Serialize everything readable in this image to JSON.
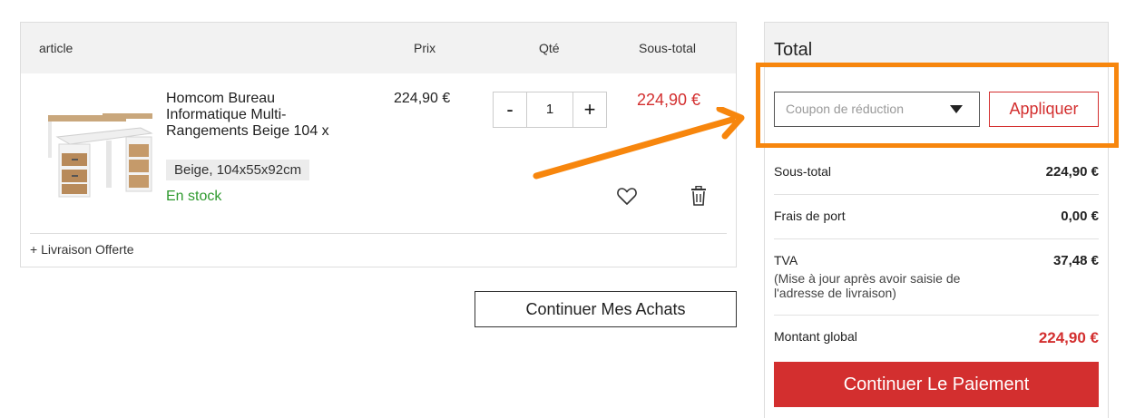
{
  "cart": {
    "headers": {
      "article": "article",
      "prix": "Prix",
      "qte": "Qté",
      "sous_total": "Sous-total"
    },
    "product": {
      "name": "Homcom Bureau Informatique Multi-Rangements Beige 104 x",
      "variant": "Beige, 104x55x92cm",
      "stock": "En stock",
      "price": "224,90 €",
      "quantity": "1",
      "qty_minus": "-",
      "qty_plus": "+",
      "subtotal": "224,90 €"
    },
    "shipping_note": "+ Livraison Offerte",
    "continue_label": "Continuer Mes Achats"
  },
  "summary": {
    "title": "Total",
    "coupon_placeholder": "Coupon de réduction",
    "apply_label": "Appliquer",
    "rows": [
      {
        "label": "Sous-total",
        "value": "224,90 €"
      },
      {
        "label": "Frais de port",
        "value": "0,00 €"
      },
      {
        "label": "TVA",
        "value": "37,48 €",
        "note": "(Mise à jour après avoir saisie de l'adresse de livraison)"
      },
      {
        "label": "Montant global",
        "value": "224,90 €"
      }
    ],
    "pay_label": "Continuer Le Paiement"
  },
  "colors": {
    "accent_red": "#d32f2f",
    "stock_green": "#2f9a2f",
    "annotation_orange": "#f7860d"
  },
  "icons": [
    "heart-icon",
    "trash-icon",
    "caret-down-icon",
    "annotation-arrow"
  ]
}
